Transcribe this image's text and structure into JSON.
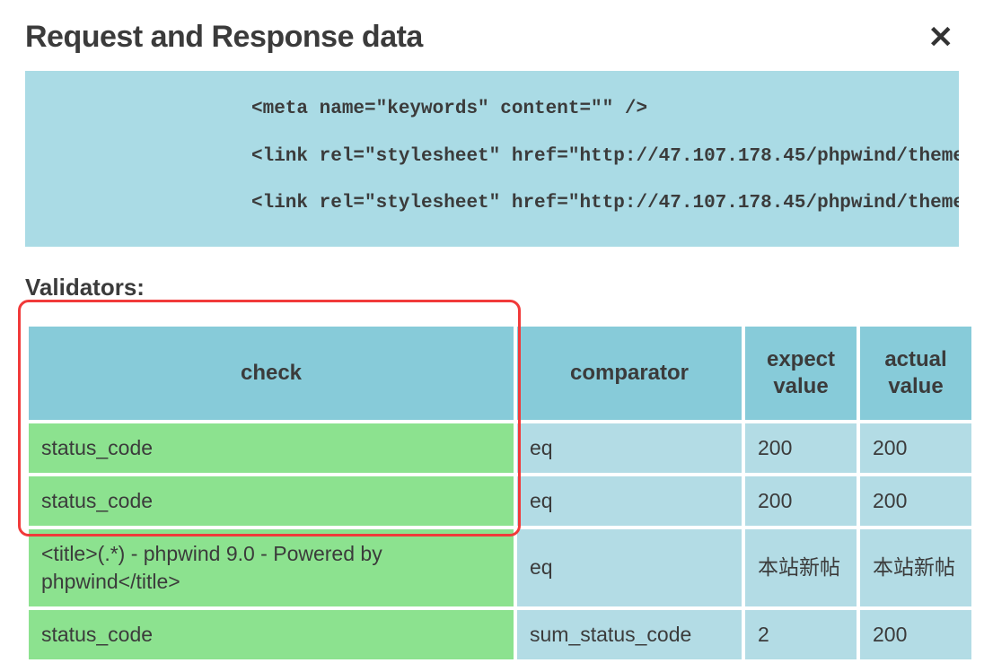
{
  "header": {
    "title": "Request and Response data"
  },
  "code_block": {
    "lines": [
      "<meta name=\"keywords\" content=\"\" />",
      "<link rel=\"stylesheet\" href=\"http://47.107.178.45/phpwind/themes",
      "<link rel=\"stylesheet\" href=\"http://47.107.178.45/phpwind/themes"
    ]
  },
  "validators": {
    "heading": "Validators:",
    "columns": {
      "check": "check",
      "comparator": "comparator",
      "expect": "expect value",
      "actual": "actual value"
    },
    "rows": [
      {
        "check": "status_code",
        "comparator": "eq",
        "expect": "200",
        "actual": "200"
      },
      {
        "check": "status_code",
        "comparator": "eq",
        "expect": "200",
        "actual": "200"
      },
      {
        "check": "<title>(.*) - phpwind 9.0 - Powered by phpwind</title>",
        "comparator": "eq",
        "expect": "本站新帖",
        "actual": "本站新帖"
      },
      {
        "check": "status_code",
        "comparator": "sum_status_code",
        "expect": "2",
        "actual": "200"
      }
    ]
  }
}
